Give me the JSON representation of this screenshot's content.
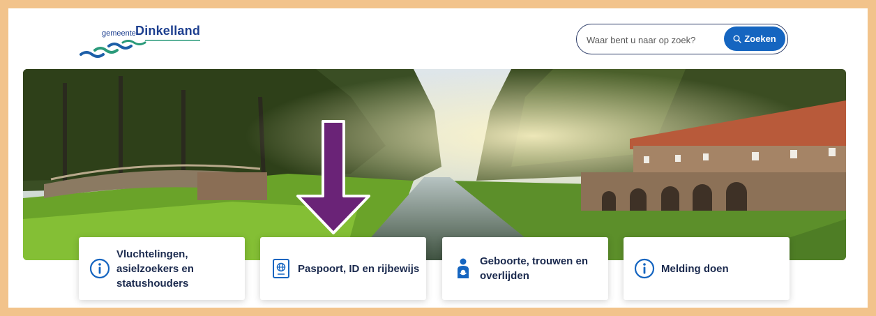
{
  "header": {
    "logo": {
      "prefix": "gemeente",
      "name": "Dinkelland"
    },
    "search": {
      "placeholder": "Waar bent u naar op zoek?",
      "button_label": "Zoeken"
    }
  },
  "hero": {
    "image": "canal-landscape-with-bridge-and-arched-brick-building",
    "annotation": "purple-down-arrow"
  },
  "tiles": [
    {
      "label": "Vluchtelingen, asielzoekers en statushouders",
      "icon": "info-circle-icon"
    },
    {
      "label": "Paspoort, ID en rijbewijs",
      "icon": "passport-icon"
    },
    {
      "label": "Geboorte, trouwen en overlijden",
      "icon": "person-baby-icon"
    },
    {
      "label": "Melding doen",
      "icon": "info-circle-icon"
    }
  ],
  "colors": {
    "frame_border": "#f2c38b",
    "brand_blue": "#1565c0",
    "text_dark": "#1b2a4e",
    "arrow_purple": "#6a2377"
  }
}
